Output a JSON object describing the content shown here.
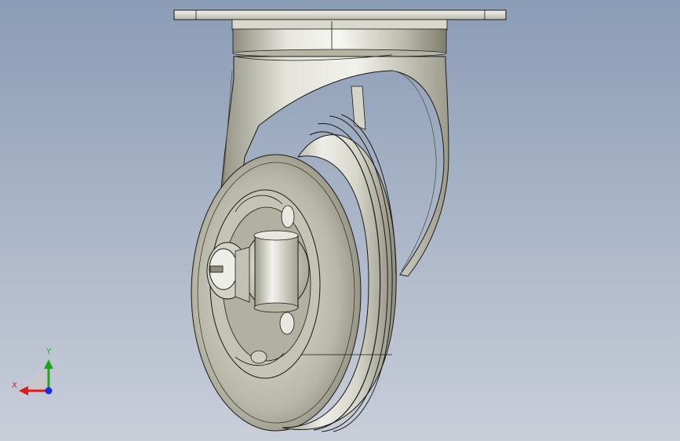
{
  "triad": {
    "x_label": "X",
    "y_label": "Y",
    "colors": {
      "x_axis": "#e01818",
      "y_axis": "#1aa81a",
      "z_axis": "#1a2ee0",
      "plane": "#c8c8c8"
    }
  },
  "model": {
    "colors": {
      "background_top": "#8b9cb6",
      "background_bottom": "#c9ced9",
      "metal_light": "#f2f2ec",
      "metal_mid": "#c9c8bb",
      "metal_dark": "#7d7c6c",
      "edge": "#1a1a14"
    }
  }
}
